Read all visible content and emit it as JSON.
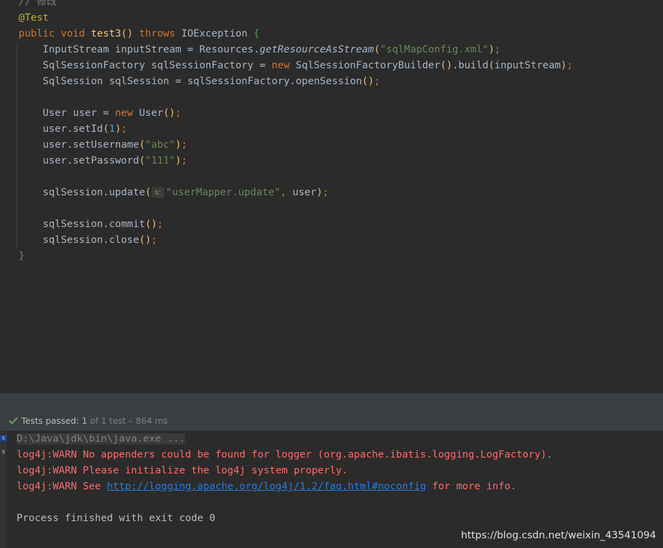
{
  "editor": {
    "comment": "// 修改",
    "annotation": "@Test",
    "method": {
      "kw_public": "public",
      "kw_void": "void",
      "name": "test3",
      "kw_throws": "throws",
      "exception": "IOException"
    },
    "lines": {
      "l1_type": "InputStream",
      "l1_var": "inputStream",
      "l1_cls": "Resources",
      "l1_method": "getResourceAsStream",
      "l1_arg": "\"sqlMapConfig.xml\"",
      "l2_type": "SqlSessionFactory",
      "l2_var": "sqlSessionFactory",
      "l2_kw_new": "new",
      "l2_cls": "SqlSessionFactoryBuilder",
      "l2_build": "build",
      "l2_arg": "inputStream",
      "l3_type": "SqlSession",
      "l3_var": "sqlSession",
      "l3_call": "sqlSessionFactory",
      "l3_method": "openSession",
      "l4_type": "User",
      "l4_var": "user",
      "l4_kw_new": "new",
      "l4_cls": "User",
      "l5_call": "user.setId",
      "l5_arg": "1",
      "l6_call": "user.setUsername",
      "l6_arg": "\"abc\"",
      "l7_call": "user.setPassword",
      "l7_arg": "\"111\"",
      "l8_call": "sqlSession.update",
      "l8_hint": "s:",
      "l8_arg1": "\"userMapper.update\"",
      "l8_arg2": "user",
      "l9_call": "sqlSession.commit",
      "l10_call": "sqlSession.close"
    }
  },
  "test_status": {
    "label": "Tests passed:",
    "passed": "1",
    "of_text": "of 1 test",
    "duration": "– 864 ms"
  },
  "console": {
    "command": "D:\\Java\\jdk\\bin\\java.exe ...",
    "warn1": "log4j:WARN No appenders could be found for logger (org.apache.ibatis.logging.LogFactory).",
    "warn2": "log4j:WARN Please initialize the log4j system properly.",
    "warn3_prefix": "log4j:WARN See ",
    "warn3_link": "http://logging.apache.org/log4j/1.2/faq.html#noconfig",
    "warn3_suffix": " for more info.",
    "exit": "Process finished with exit code 0",
    "gutter_marks": [
      "s",
      "s"
    ]
  },
  "watermark": "https://blog.csdn.net/weixin_43541094",
  "colors": {
    "background": "#2b2b2b",
    "keyword": "#cc7832",
    "string": "#6a8759",
    "number": "#6897bb",
    "function": "#ffc66d",
    "warn": "#ff6b68",
    "link": "#287bde",
    "pass": "#5fa35f"
  }
}
